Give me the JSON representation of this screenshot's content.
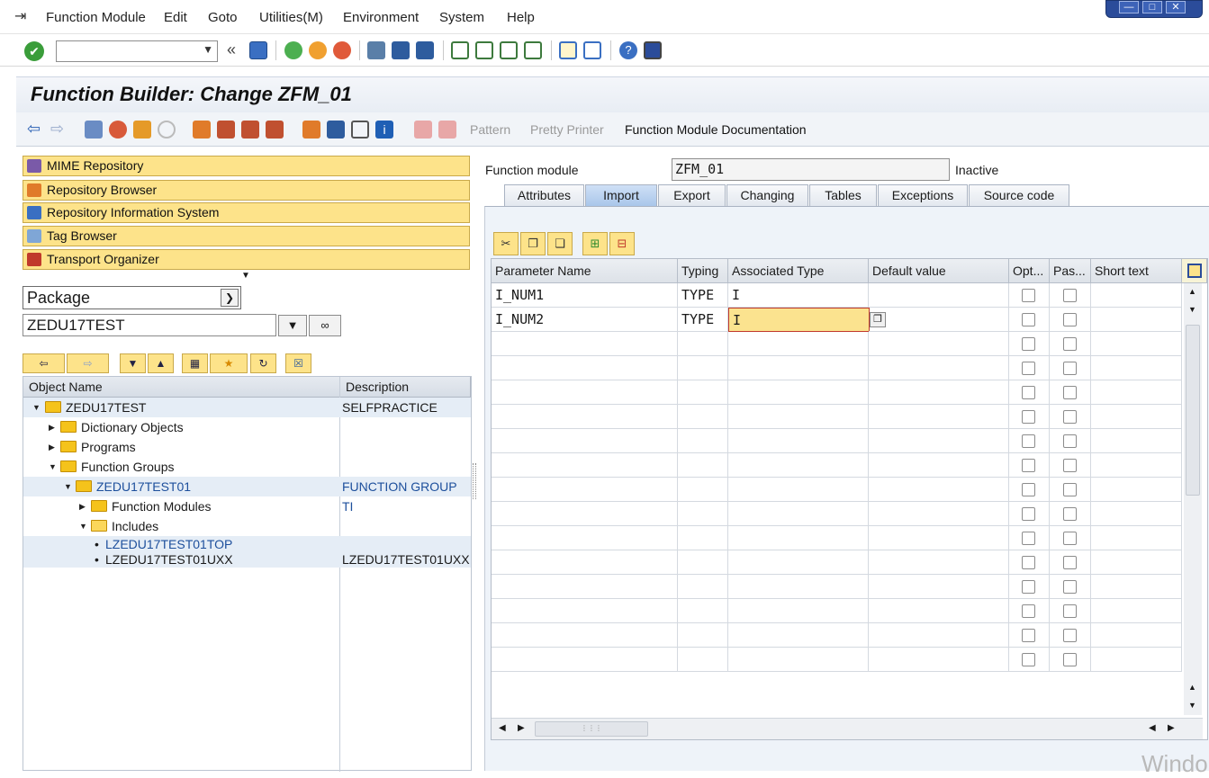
{
  "menubar": {
    "items": [
      "Function Module",
      "Edit",
      "Goto",
      "Utilities(M)",
      "Environment",
      "System",
      "Help"
    ]
  },
  "standard_toolbar": {
    "command_field_value": "",
    "back_double": "«"
  },
  "screen": {
    "title": "Function Builder: Change ZFM_01"
  },
  "app_toolbar": {
    "pattern": "Pattern",
    "pretty_printer": "Pretty Printer",
    "documentation": "Function Module Documentation"
  },
  "navigator": {
    "buttons": [
      "MIME Repository",
      "Repository Browser",
      "Repository Information System",
      "Tag Browser",
      "Transport Organizer"
    ],
    "object_type": "Package",
    "package_value": "ZEDU17TEST"
  },
  "tree": {
    "columns": [
      "Object Name",
      "Description"
    ],
    "rows": [
      {
        "name": "ZEDU17TEST",
        "desc": "SELFPRACTICE"
      },
      {
        "name": "Dictionary Objects",
        "desc": ""
      },
      {
        "name": "Programs",
        "desc": ""
      },
      {
        "name": "Function Groups",
        "desc": ""
      },
      {
        "name": "ZEDU17TEST01",
        "desc": "FUNCTION GROUP TI"
      },
      {
        "name": "Function Modules",
        "desc": ""
      },
      {
        "name": "Includes",
        "desc": ""
      },
      {
        "name": "LZEDU17TEST01TOP",
        "desc": ""
      },
      {
        "name": "LZEDU17TEST01UXX",
        "desc": "LZEDU17TEST01UXX"
      }
    ]
  },
  "function_module": {
    "label": "Function module",
    "value": "ZFM_01",
    "status": "Inactive"
  },
  "tabs": [
    "Attributes",
    "Import",
    "Export",
    "Changing",
    "Tables",
    "Exceptions",
    "Source code"
  ],
  "active_tab": "Import",
  "grid": {
    "columns": [
      "Parameter Name",
      "Typing",
      "Associated Type",
      "Default value",
      "Opt...",
      "Pas...",
      "Short text"
    ],
    "rows": [
      {
        "name": "I_NUM1",
        "typing": "TYPE",
        "assoc": "I",
        "default": ""
      },
      {
        "name": "I_NUM2",
        "typing": "TYPE",
        "assoc": "I",
        "default": ""
      }
    ],
    "checkbox_rows": 16
  },
  "watermark": "Windo"
}
